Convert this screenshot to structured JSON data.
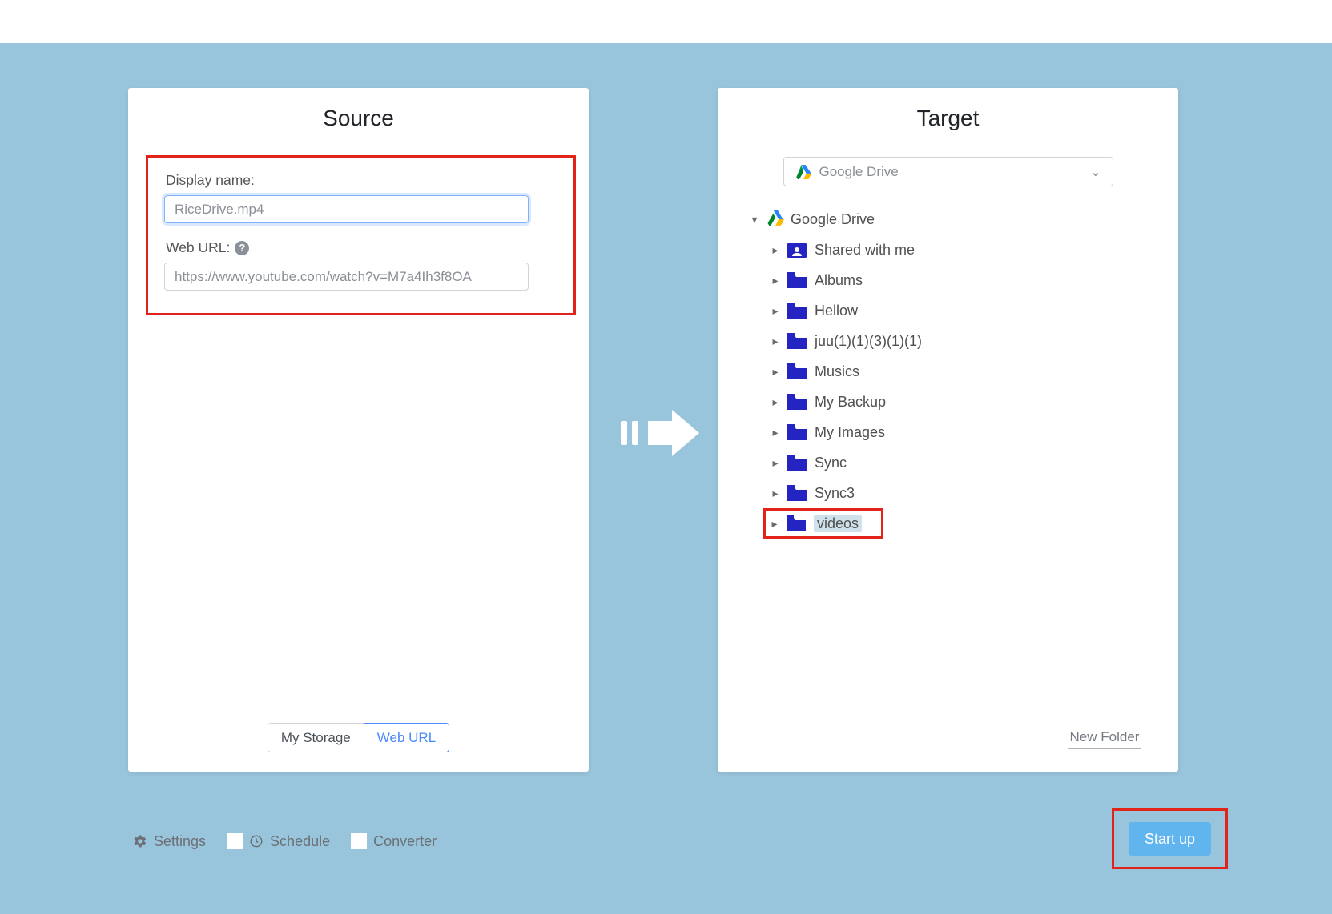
{
  "source": {
    "title": "Source",
    "display_name_label": "Display name:",
    "display_name_value": "RiceDrive.mp4",
    "web_url_label": "Web URL:",
    "web_url_value": "https://www.youtube.com/watch?v=M7a4Ih3f8OA",
    "tabs": {
      "my_storage": "My Storage",
      "web_url": "Web URL"
    }
  },
  "target": {
    "title": "Target",
    "select_label": "Google Drive",
    "root_label": "Google Drive",
    "folders": [
      {
        "name": "Shared with me",
        "icon": "shared"
      },
      {
        "name": "Albums",
        "icon": "folder"
      },
      {
        "name": "Hellow",
        "icon": "folder"
      },
      {
        "name": "juu(1)(1)(3)(1)(1)",
        "icon": "folder"
      },
      {
        "name": "Musics",
        "icon": "folder"
      },
      {
        "name": "My Backup",
        "icon": "folder"
      },
      {
        "name": "My Images",
        "icon": "folder"
      },
      {
        "name": "Sync",
        "icon": "folder"
      },
      {
        "name": "Sync3",
        "icon": "folder"
      },
      {
        "name": "videos",
        "icon": "folder",
        "selected": true,
        "highlighted": true
      }
    ],
    "new_folder": "New Folder"
  },
  "footer": {
    "settings": "Settings",
    "schedule": "Schedule",
    "converter": "Converter",
    "start": "Start up"
  }
}
